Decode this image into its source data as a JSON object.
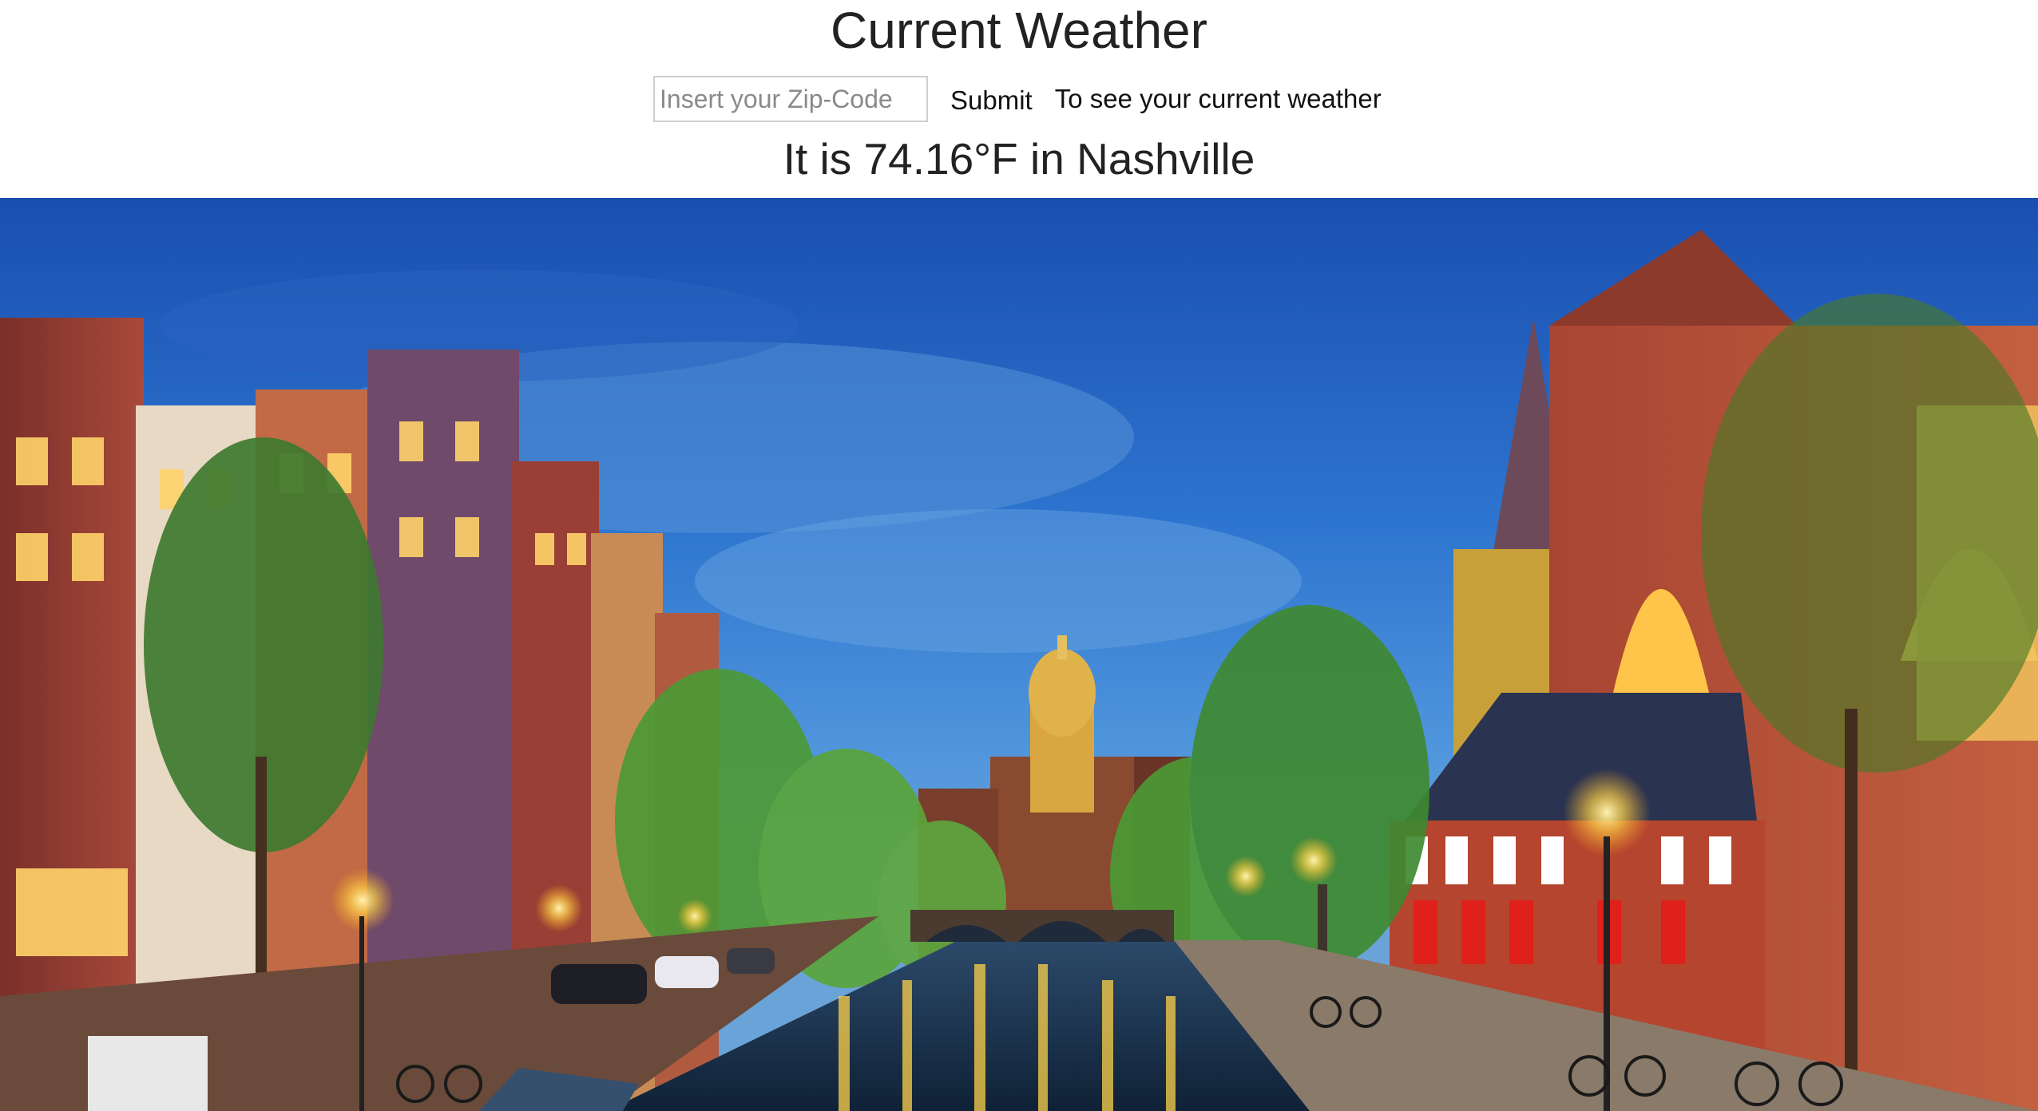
{
  "page": {
    "title": "Current Weather",
    "zip_input": {
      "value": "",
      "placeholder": "Insert your Zip-Code"
    },
    "submit_label": "Submit",
    "hint_text": "To see your current weather",
    "result_text": "It is 74.16°F in Nashville"
  },
  "background_image": {
    "subject": "evening canal city scene with bridge, domed church and street lamps"
  },
  "colors": {
    "sky_top": "#1f56b8",
    "sky_mid": "#3b86d6",
    "water": "#1a3a5c",
    "lamp": "#ffd24a",
    "tree": "#3d8a35",
    "brick": "#b5523f",
    "text": "#222222"
  }
}
